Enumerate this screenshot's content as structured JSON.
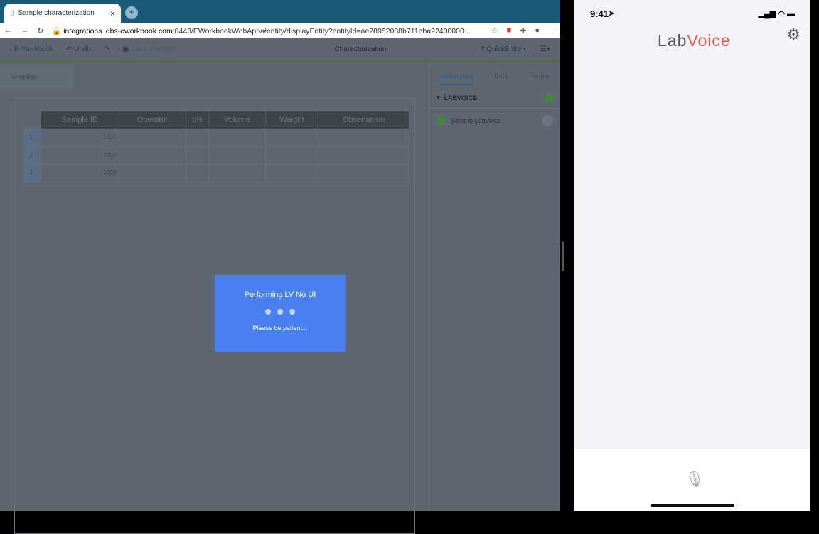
{
  "browser": {
    "tab_title": "Sample characterization",
    "url_host": "integrations.idbs-eworkbook.com",
    "url_rest": ":8443/EWorkbookWebApp/#entity/displayEntity?entityId=ae28952088b711eba22400000..."
  },
  "toolbar": {
    "back": "E-Workbook",
    "undo": "Undo",
    "save": "Save changes",
    "title": "Characterization",
    "quick_entry": "QuickEntry"
  },
  "workflow": "Workflow",
  "table": {
    "headers": [
      "Sample ID",
      "Operator",
      "pH",
      "Volume",
      "Weight",
      "Observation"
    ],
    "rows": [
      {
        "n": "1",
        "id": "1001"
      },
      {
        "n": "2",
        "id": "1002"
      },
      {
        "n": "3",
        "id": "1003"
      }
    ]
  },
  "side": {
    "tabs": [
      "Instructions",
      "Data",
      "Format"
    ],
    "section": "LABVOICE",
    "item": "Send to LabVoice"
  },
  "modal": {
    "title": "Performing LV No UI",
    "sub": "Please be patient..."
  },
  "phone": {
    "time": "9:41",
    "logo_a": "Lab",
    "logo_b": "Voice"
  }
}
